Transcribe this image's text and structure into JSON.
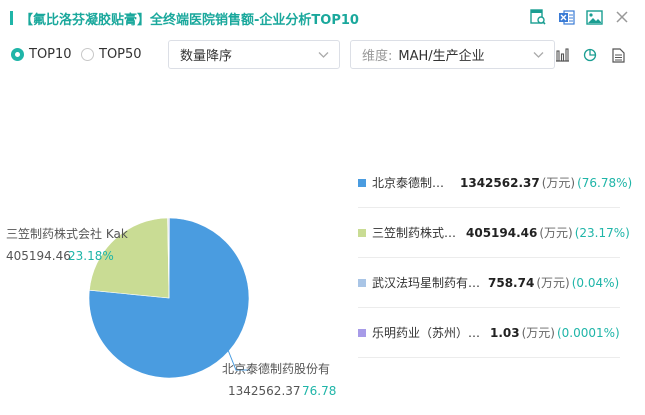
{
  "header": {
    "title": "【氟比洛芬凝胶贴膏】全终端医院销售额-企业分析TOP10",
    "icons": [
      "table-search-icon",
      "excel-export-icon",
      "image-export-icon",
      "close-icon"
    ]
  },
  "controls": {
    "radio_options": [
      {
        "label": "TOP10",
        "checked": true
      },
      {
        "label": "TOP50",
        "checked": false
      }
    ],
    "sort_select": {
      "value": "数量降序"
    },
    "dimension_select": {
      "prefix": "维度:",
      "value": "MAH/生产企业"
    },
    "chart_type_icons": [
      "bar-chart-icon",
      "pie-chart-icon",
      "document-icon"
    ]
  },
  "colors": {
    "accent": "#1fb5a8",
    "series": [
      "#4a9ce0",
      "#c9dc94",
      "#a9c5e6",
      "#a79be8"
    ]
  },
  "chart_data": {
    "type": "pie",
    "unit": "(万元)",
    "series": [
      {
        "name": "北京泰德制…",
        "full_label": "北京泰德制药股份有",
        "value": 1342562.37,
        "value_text": "1342562.37",
        "percent": 76.78,
        "percent_text": "(76.78%)",
        "label_pct": "76.78"
      },
      {
        "name": "三笠制药株式…",
        "full_label": "三笠制药株式会社 Kak…",
        "value": 405194.46,
        "value_text": "405194.46",
        "percent": 23.17,
        "percent_text": "(23.17%)",
        "label_pct": "23.18%"
      },
      {
        "name": "武汉法玛星制药有…",
        "value": 758.74,
        "value_text": "758.74",
        "percent": 0.04,
        "percent_text": "(0.04%)"
      },
      {
        "name": "乐明药业（苏州）…",
        "value": 1.03,
        "value_text": "1.03",
        "percent": 0.0001,
        "percent_text": "(0.0001%)"
      }
    ],
    "slice_labels": [
      {
        "line1": "三笠制药株式会社 Kak",
        "value": "405194.46",
        "pct": "23.18%"
      },
      {
        "line1": "北京泰德制药股份有",
        "value": "1342562.37",
        "pct": "76.78"
      }
    ]
  }
}
